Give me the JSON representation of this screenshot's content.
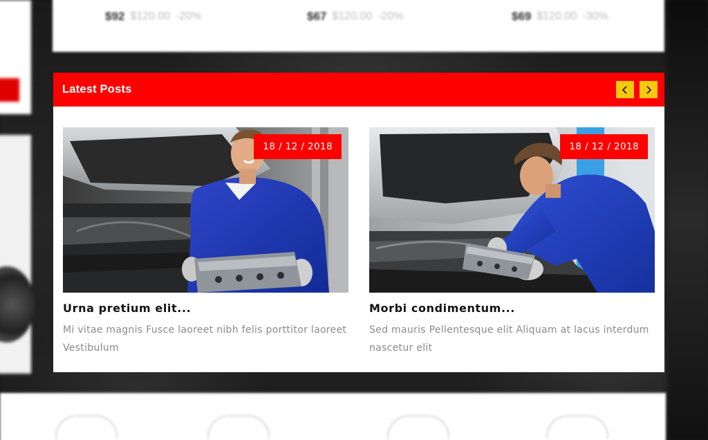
{
  "top_products": {
    "prices": [
      {
        "current": "$92",
        "old": "$120.00",
        "extra": "-20%"
      },
      {
        "current": "$67",
        "old": "$120.00",
        "extra": "-20%"
      },
      {
        "current": "$69",
        "old": "$120.00",
        "extra": "-30%"
      }
    ]
  },
  "latest_posts": {
    "title": "Latest Posts",
    "prev_icon": "chevron-left-icon",
    "next_icon": "chevron-right-icon",
    "accent_color": "#ff0000",
    "nav_color": "#f7c90d",
    "posts": [
      {
        "date": "18 / 12 / 2018",
        "title": "Urna pretium elit...",
        "excerpt": "Mi vitae magnis Fusce laoreet nibh felis porttitor laoreet Vestibulum"
      },
      {
        "date": "18 / 12 / 2018",
        "title": "Morbi condimentum...",
        "excerpt": "Sed mauris Pellentesque elit Aliquam at lacus interdum nascetur elit"
      }
    ]
  }
}
